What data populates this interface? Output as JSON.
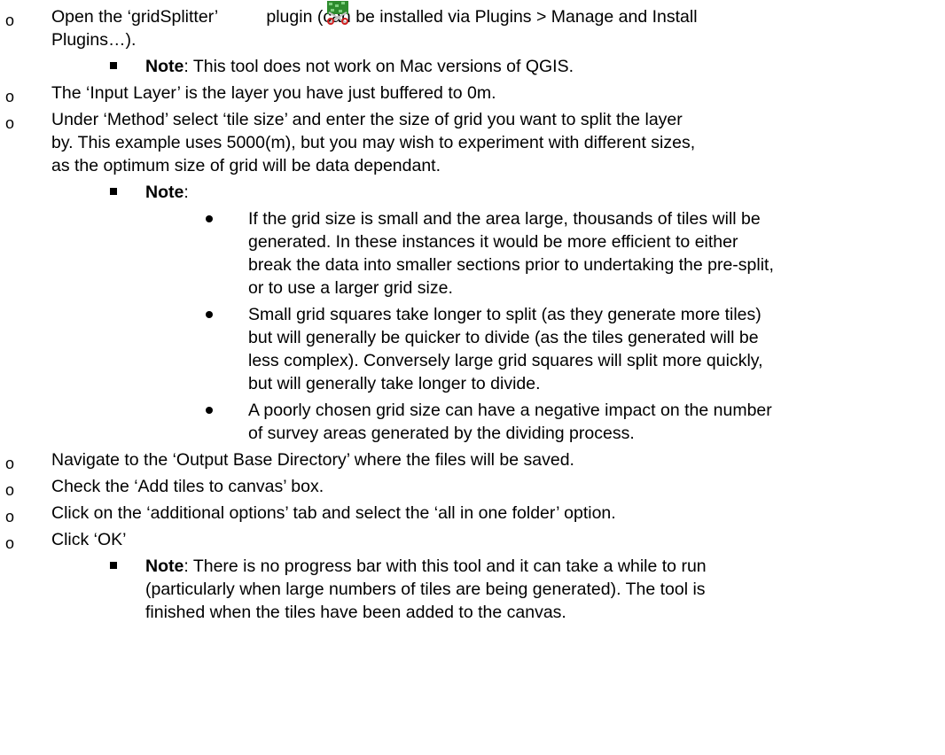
{
  "items": [
    {
      "line1_pre": "Open the ‘gridSplitter’",
      "line1_post": "plugin (can be installed via Plugins > Manage and Install",
      "line2": "Plugins…).",
      "note": {
        "bold": "Note",
        "text": ": This tool does not work on Mac versions of QGIS."
      }
    },
    {
      "text": "The ‘Input Layer’ is the layer you have just buffered to 0m."
    },
    {
      "lines": [
        "Under ‘Method’ select ‘tile size’ and enter the size of grid you want to split the layer",
        "by.  This example uses 5000(m), but you may wish to experiment with different sizes,",
        "as the optimum size of grid will be data dependant."
      ],
      "note": {
        "bold": "Note",
        "text": ":"
      },
      "bullets": [
        [
          "If the grid size is small and the area large, thousands of tiles will be",
          "generated.  In these instances it would be more efficient to either",
          "break the data into smaller sections prior to undertaking the pre-split,",
          "or to use a larger grid size."
        ],
        [
          "Small grid squares take longer to split (as they generate more tiles)",
          "but will generally be quicker to divide (as the tiles generated will be",
          "less complex).  Conversely large grid squares will split more quickly,",
          "but will generally take longer to divide."
        ],
        [
          "A poorly chosen grid size can have a negative impact on the number",
          "of survey areas generated by the dividing process."
        ]
      ]
    },
    {
      "text": "Navigate to the ‘Output Base Directory’ where the files will be saved."
    },
    {
      "text": "Check the ‘Add tiles to canvas’ box."
    },
    {
      "text": "Click on the ‘additional options’ tab and select the ‘all in one folder’ option."
    },
    {
      "text": "Click ‘OK’",
      "note": {
        "bold": "Note",
        "lines": [
          ": There is no progress bar with this tool and it can take a while to run",
          "(particularly when large numbers of tiles are being generated).  The tool is",
          "finished when the tiles have been added to the canvas."
        ]
      }
    }
  ],
  "markers": {
    "level1": "o"
  },
  "icon": "gridsplitter-plugin-icon"
}
